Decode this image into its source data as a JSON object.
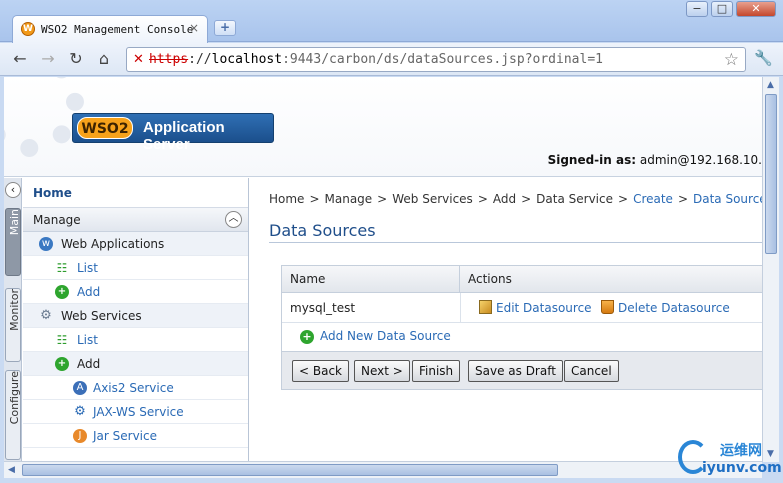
{
  "browser": {
    "tab_title": "WSO2 Management Console",
    "tab_close": "×",
    "new_tab": "+",
    "url_scheme": "https",
    "url_sep": "://",
    "url_host": "localhost",
    "url_path": ":9443/carbon/ds/dataSources.jsp?ordinal=1",
    "window_buttons": [
      "−",
      "□",
      "✕"
    ],
    "nav_icons": [
      "back-arrow-icon",
      "forward-arrow-icon",
      "reload-icon",
      "home-icon"
    ]
  },
  "header": {
    "logo_mark": "WSO2",
    "logo_text": "Application Server",
    "signed_in_label": "Signed-in as:",
    "signed_in_user": "admin@192.168.10."
  },
  "rail": {
    "tabs": [
      "Main",
      "Monitor",
      "Configure"
    ],
    "toggle": "‹"
  },
  "menu": {
    "home": "Home",
    "section": "Manage",
    "collapse": "︿",
    "items": [
      {
        "label": "Web Applications",
        "kind": "cat",
        "icon": "web-applications-icon"
      },
      {
        "label": "List",
        "kind": "sub",
        "icon": "list-icon"
      },
      {
        "label": "Add",
        "kind": "sub",
        "icon": "add-icon"
      },
      {
        "label": "Web Services",
        "kind": "cat",
        "icon": "gear-icon"
      },
      {
        "label": "List",
        "kind": "sub",
        "icon": "list-icon"
      },
      {
        "label": "Add",
        "kind": "cat",
        "icon": "add-icon"
      },
      {
        "label": "Axis2 Service",
        "kind": "sub2",
        "icon": "axis2-service-icon"
      },
      {
        "label": "JAX-WS Service",
        "kind": "sub2",
        "icon": "jaxws-service-icon"
      },
      {
        "label": "Jar Service",
        "kind": "sub2",
        "icon": "jar-service-icon"
      }
    ]
  },
  "content": {
    "breadcrumb": [
      {
        "label": "Home",
        "link": false
      },
      {
        "label": "Manage",
        "link": false
      },
      {
        "label": "Web Services",
        "link": false
      },
      {
        "label": "Add",
        "link": false
      },
      {
        "label": "Data Service",
        "link": false
      },
      {
        "label": "Create",
        "link": true
      },
      {
        "label": "Data Sources",
        "link": true
      }
    ],
    "breadcrumb_sep": ">",
    "title": "Data Sources",
    "table": {
      "headers": [
        "Name",
        "Actions"
      ],
      "rows": [
        {
          "name": "mysql_test",
          "edit": "Edit Datasource",
          "delete": "Delete Datasource"
        }
      ],
      "add_label": "Add New Data Source"
    },
    "buttons": [
      "< Back",
      "Next >",
      "Finish",
      "Save as Draft",
      "Cancel"
    ]
  },
  "watermark": {
    "top": "运维网",
    "bottom": "iyunv.com"
  }
}
